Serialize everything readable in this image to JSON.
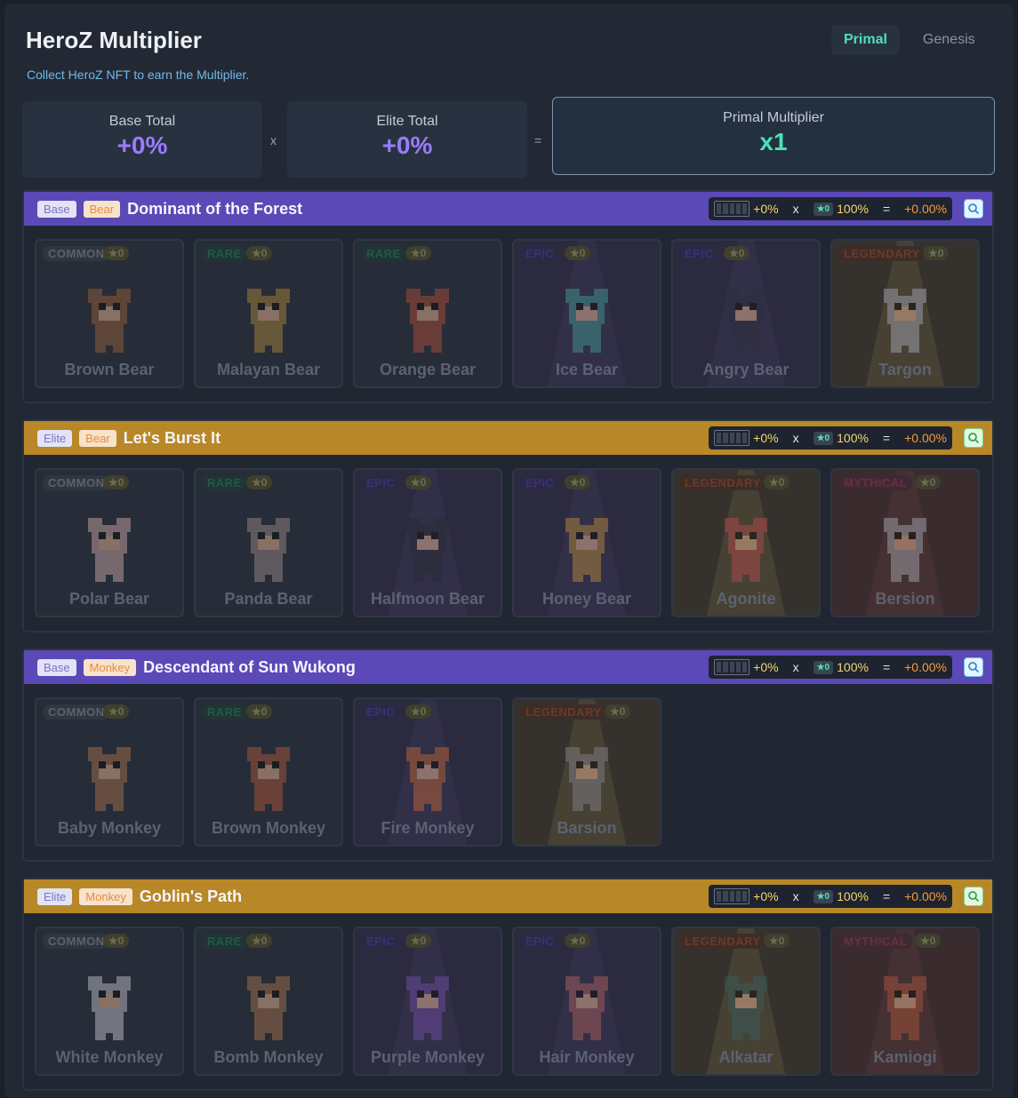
{
  "header": {
    "title": "HeroZ Multiplier",
    "subtitle": "Collect HeroZ NFT to earn the Multiplier.",
    "tabs": [
      {
        "label": "Primal",
        "active": true
      },
      {
        "label": "Genesis",
        "active": false
      }
    ]
  },
  "summary": {
    "base_label": "Base Total",
    "base_value": "+0%",
    "times": "x",
    "elite_label": "Elite Total",
    "elite_value": "+0%",
    "equals": "=",
    "total_label": "Primal Multiplier",
    "total_value": "x1"
  },
  "colors": {
    "accent_green": "#4fe0b8",
    "accent_purple": "#9a7bff",
    "base_header": "#5b49b8",
    "elite_header": "#b88727"
  },
  "sections": [
    {
      "type": "Base",
      "family": "Bear",
      "title": "Dominant of the Forest",
      "formula": {
        "pct": "+0%",
        "times": "x",
        "star": "★0",
        "rate": "100%",
        "equals": "=",
        "result": "+0.00%"
      },
      "cards": [
        {
          "rarity": "COMMON",
          "stars": "★0",
          "name": "Brown Bear",
          "color": "#8a5a3a"
        },
        {
          "rarity": "RARE",
          "stars": "★0",
          "name": "Malayan Bear",
          "color": "#9a7a3a"
        },
        {
          "rarity": "RARE",
          "stars": "★0",
          "name": "Orange Bear",
          "color": "#a04a3a"
        },
        {
          "rarity": "EPIC",
          "stars": "★0",
          "name": "Ice Bear",
          "color": "#3f8f88"
        },
        {
          "rarity": "EPIC",
          "stars": "★0",
          "name": "Angry Bear",
          "color": "#2f2f3f"
        },
        {
          "rarity": "LEGENDARY",
          "stars": "★0",
          "name": "Targon",
          "color": "#9a9aa8"
        }
      ]
    },
    {
      "type": "Elite",
      "family": "Bear",
      "title": "Let's Burst It",
      "formula": {
        "pct": "+0%",
        "times": "x",
        "star": "★0",
        "rate": "100%",
        "equals": "=",
        "result": "+0.00%"
      },
      "cards": [
        {
          "rarity": "COMMON",
          "stars": "★0",
          "name": "Polar Bear",
          "color": "#b89a9a"
        },
        {
          "rarity": "RARE",
          "stars": "★0",
          "name": "Panda Bear",
          "color": "#8f7f7f"
        },
        {
          "rarity": "EPIC",
          "stars": "★0",
          "name": "Halfmoon Bear",
          "color": "#2a2c38"
        },
        {
          "rarity": "EPIC",
          "stars": "★0",
          "name": "Honey Bear",
          "color": "#a8803a"
        },
        {
          "rarity": "LEGENDARY",
          "stars": "★0",
          "name": "Agonite",
          "color": "#a84a4a"
        },
        {
          "rarity": "MYTHICAL",
          "stars": "★0",
          "name": "Bersion",
          "color": "#9a9aa0"
        }
      ]
    },
    {
      "type": "Base",
      "family": "Monkey",
      "title": "Descendant of Sun Wukong",
      "formula": {
        "pct": "+0%",
        "times": "x",
        "star": "★0",
        "rate": "100%",
        "equals": "=",
        "result": "+0.00%"
      },
      "cards": [
        {
          "rarity": "COMMON",
          "stars": "★0",
          "name": "Baby Monkey",
          "color": "#9a6a4a"
        },
        {
          "rarity": "RARE",
          "stars": "★0",
          "name": "Brown Monkey",
          "color": "#a0523a"
        },
        {
          "rarity": "EPIC",
          "stars": "★0",
          "name": "Fire Monkey",
          "color": "#b0603a"
        },
        {
          "rarity": "LEGENDARY",
          "stars": "★0",
          "name": "Barsion",
          "color": "#7a7a82"
        }
      ]
    },
    {
      "type": "Elite",
      "family": "Monkey",
      "title": "Goblin's Path",
      "formula": {
        "pct": "+0%",
        "times": "x",
        "star": "★0",
        "rate": "100%",
        "equals": "=",
        "result": "+0.00%"
      },
      "cards": [
        {
          "rarity": "COMMON",
          "stars": "★0",
          "name": "White Monkey",
          "color": "#b0b0b8"
        },
        {
          "rarity": "RARE",
          "stars": "★0",
          "name": "Bomb Monkey",
          "color": "#9a6a4a"
        },
        {
          "rarity": "EPIC",
          "stars": "★0",
          "name": "Purple Monkey",
          "color": "#6a4a9a"
        },
        {
          "rarity": "EPIC",
          "stars": "★0",
          "name": "Hair Monkey",
          "color": "#a05a5a"
        },
        {
          "rarity": "LEGENDARY",
          "stars": "★0",
          "name": "Alkatar",
          "color": "#3a5a5a"
        },
        {
          "rarity": "MYTHICAL",
          "stars": "★0",
          "name": "Kamiogi",
          "color": "#a0503a"
        }
      ]
    }
  ]
}
